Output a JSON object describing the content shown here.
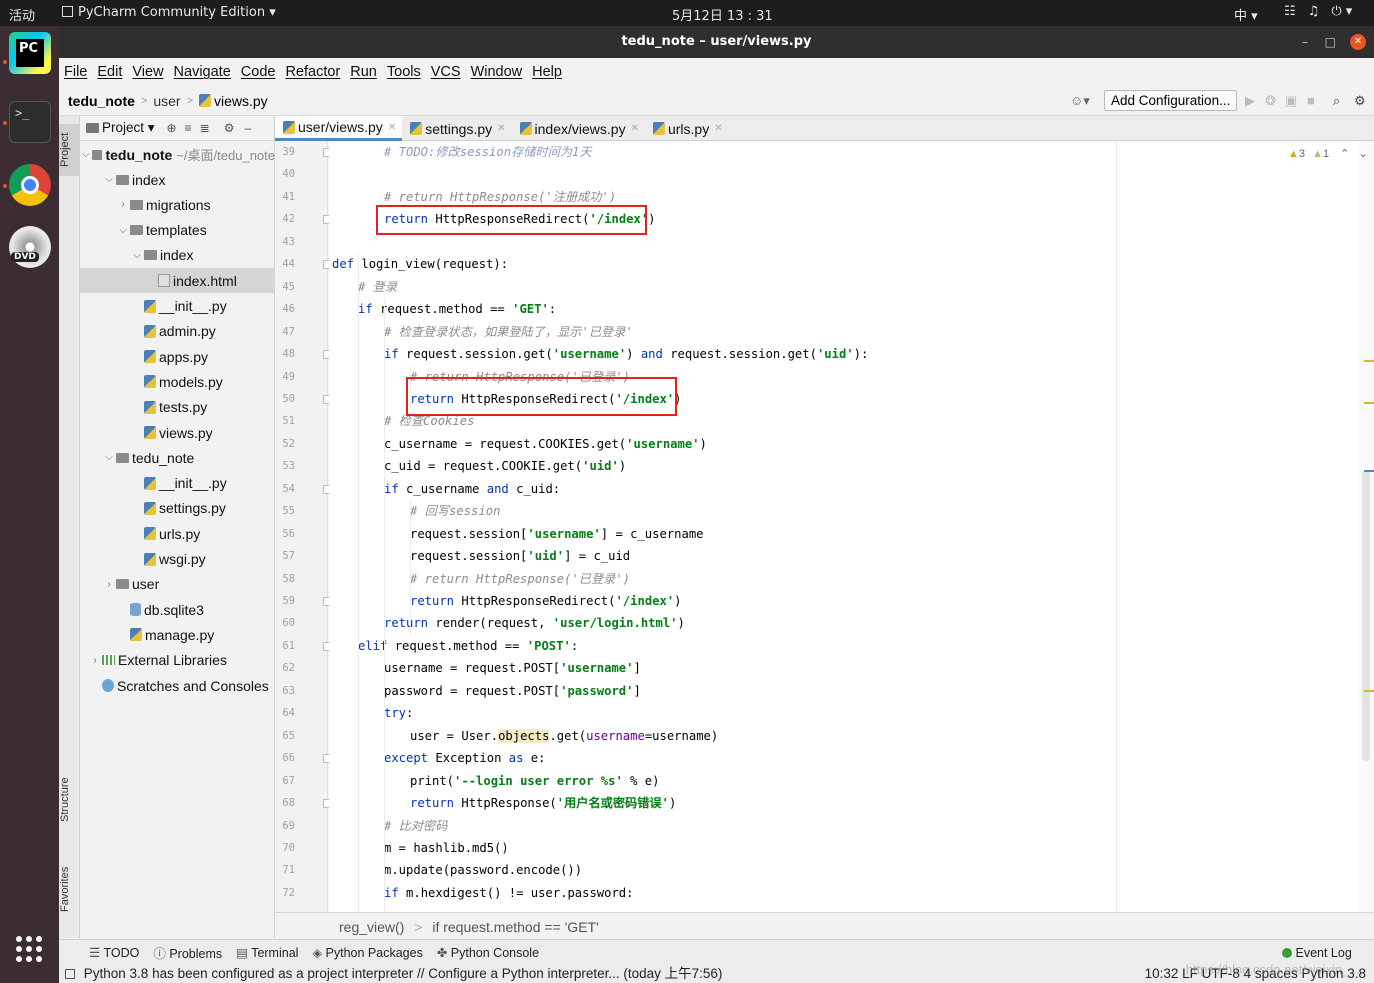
{
  "topbar": {
    "activities": "活动",
    "app_menu": "PyCharm Community Edition ▾",
    "clock": "5月12日 13 : 31",
    "ime": "中 ▾"
  },
  "window": {
    "title": "tedu_note – user/views.py"
  },
  "menu": [
    "File",
    "Edit",
    "View",
    "Navigate",
    "Code",
    "Refactor",
    "Run",
    "Tools",
    "VCS",
    "Window",
    "Help"
  ],
  "nav": {
    "project": "tedu_note",
    "folder": "user",
    "file": "views.py",
    "add_config": "Add Configuration..."
  },
  "sidestrip": {
    "project": "Project",
    "structure": "Structure",
    "favorites": "Favorites"
  },
  "project_panel": {
    "label": "Project ▾",
    "root_name": "tedu_note",
    "root_path": "~/桌面/tedu_note"
  },
  "tree": [
    {
      "label": "index",
      "type": "folder",
      "depth": 1,
      "arrow": "open"
    },
    {
      "label": "migrations",
      "type": "folder",
      "depth": 2,
      "arrow": "closed"
    },
    {
      "label": "templates",
      "type": "folder",
      "depth": 2,
      "arrow": "open"
    },
    {
      "label": "index",
      "type": "folder",
      "depth": 3,
      "arrow": "open"
    },
    {
      "label": "index.html",
      "type": "html",
      "depth": 4,
      "arrow": "none",
      "selected": true
    },
    {
      "label": "__init__.py",
      "type": "py",
      "depth": 3,
      "arrow": "none"
    },
    {
      "label": "admin.py",
      "type": "py",
      "depth": 3,
      "arrow": "none"
    },
    {
      "label": "apps.py",
      "type": "py",
      "depth": 3,
      "arrow": "none"
    },
    {
      "label": "models.py",
      "type": "py",
      "depth": 3,
      "arrow": "none"
    },
    {
      "label": "tests.py",
      "type": "py",
      "depth": 3,
      "arrow": "none"
    },
    {
      "label": "views.py",
      "type": "py",
      "depth": 3,
      "arrow": "none"
    },
    {
      "label": "tedu_note",
      "type": "folder",
      "depth": 1,
      "arrow": "open"
    },
    {
      "label": "__init__.py",
      "type": "py",
      "depth": 3,
      "arrow": "none"
    },
    {
      "label": "settings.py",
      "type": "py",
      "depth": 3,
      "arrow": "none"
    },
    {
      "label": "urls.py",
      "type": "py",
      "depth": 3,
      "arrow": "none"
    },
    {
      "label": "wsgi.py",
      "type": "py",
      "depth": 3,
      "arrow": "none"
    },
    {
      "label": "user",
      "type": "folder",
      "depth": 1,
      "arrow": "closed"
    },
    {
      "label": "db.sqlite3",
      "type": "db",
      "depth": 2,
      "arrow": "none"
    },
    {
      "label": "manage.py",
      "type": "py",
      "depth": 2,
      "arrow": "none"
    },
    {
      "label": "External Libraries",
      "type": "lib",
      "depth": 0,
      "arrow": "closed"
    },
    {
      "label": "Scratches and Consoles",
      "type": "scratch",
      "depth": 0,
      "arrow": "none"
    }
  ],
  "tabs": [
    {
      "label": "user/views.py",
      "active": true
    },
    {
      "label": "settings.py",
      "active": false
    },
    {
      "label": "index/views.py",
      "active": false
    },
    {
      "label": "urls.py",
      "active": false
    }
  ],
  "code_lines": [
    {
      "n": "39",
      "indent": 2,
      "html": "<span class='cmb'># TODO:修改session存储时间为1天</span>"
    },
    {
      "n": "40",
      "indent": 0,
      "html": ""
    },
    {
      "n": "41",
      "indent": 2,
      "html": "<span class='cm'># return HttpResponse('注册成功')</span>"
    },
    {
      "n": "42",
      "indent": 2,
      "html": "<span class='kw'>return</span> HttpResponseRedirect(<span class='str'>'/index'</span>)"
    },
    {
      "n": "43",
      "indent": 0,
      "html": ""
    },
    {
      "n": "44",
      "indent": 0,
      "html": "<span class='kw'>def</span> login_view(request):"
    },
    {
      "n": "45",
      "indent": 1,
      "html": "<span class='cm'># 登录</span>"
    },
    {
      "n": "46",
      "indent": 1,
      "html": "<span class='kw'>if</span> request.method == <span class='str'>'GET'</span>:"
    },
    {
      "n": "47",
      "indent": 2,
      "html": "<span class='cm'># 检查登录状态，如果登陆了，显示'已登录'</span>"
    },
    {
      "n": "48",
      "indent": 2,
      "html": "<span class='kw'>if</span> request.session.get(<span class='str'>'username'</span>) <span class='kw'>and</span> request.session.get(<span class='str'>'uid'</span>):"
    },
    {
      "n": "49",
      "indent": 3,
      "html": "<span class='cm'># return HttpResponse('已登录')</span>"
    },
    {
      "n": "50",
      "indent": 3,
      "html": "<span class='kw'>return</span> HttpResponseRedirect(<span class='str'>'/index'</span>)"
    },
    {
      "n": "51",
      "indent": 2,
      "html": "<span class='cm'># 检查Cookies</span>"
    },
    {
      "n": "52",
      "indent": 2,
      "html": "c_username = request.COOKIES.get(<span class='str'>'username'</span>)"
    },
    {
      "n": "53",
      "indent": 2,
      "html": "c_uid = request.COOKIE.get(<span class='str'>'uid'</span>)"
    },
    {
      "n": "54",
      "indent": 2,
      "html": "<span class='kw'>if</span> c_username <span class='kw'>and</span> c_uid:"
    },
    {
      "n": "55",
      "indent": 3,
      "html": "<span class='cm'># 回写session</span>"
    },
    {
      "n": "56",
      "indent": 3,
      "html": "request.session[<span class='str'>'username'</span>] = c_username"
    },
    {
      "n": "57",
      "indent": 3,
      "html": "request.session[<span class='str'>'uid'</span>] = c_uid"
    },
    {
      "n": "58",
      "indent": 3,
      "html": "<span class='cm'># return HttpResponse('已登录')</span>"
    },
    {
      "n": "59",
      "indent": 3,
      "html": "<span class='kw'>return</span> HttpResponseRedirect(<span class='str'>'/index'</span>)"
    },
    {
      "n": "60",
      "indent": 2,
      "html": "<span class='kw'>return</span> render(request, <span class='str'>'user/login.html'</span>)"
    },
    {
      "n": "61",
      "indent": 1,
      "html": "<span class='kw'>elif</span> request.method == <span class='str'>'POST'</span>:"
    },
    {
      "n": "62",
      "indent": 2,
      "html": "username = request.POST[<span class='str'>'username'</span>]"
    },
    {
      "n": "63",
      "indent": 2,
      "html": "password = request.POST[<span class='str'>'password'</span>]"
    },
    {
      "n": "64",
      "indent": 2,
      "html": "<span class='kw'>try</span>:"
    },
    {
      "n": "65",
      "indent": 3,
      "html": "user = User.<span class='hl'>objects</span>.get(<span class='prm'>username</span>=username)"
    },
    {
      "n": "66",
      "indent": 2,
      "html": "<span class='kw'>except</span> Exception <span class='kw'>as</span> e:"
    },
    {
      "n": "67",
      "indent": 3,
      "html": "print(<span class='str'>'--login user error %s'</span> % e)"
    },
    {
      "n": "68",
      "indent": 3,
      "html": "<span class='kw'>return</span> HttpResponse(<span class='str'>'用户名或密码错误'</span>)"
    },
    {
      "n": "69",
      "indent": 2,
      "html": "<span class='cm'># 比对密码</span>"
    },
    {
      "n": "70",
      "indent": 2,
      "html": "m = hashlib.md5()"
    },
    {
      "n": "71",
      "indent": 2,
      "html": "m.update(password.encode())"
    },
    {
      "n": "72",
      "indent": 2,
      "html": "<span class='kw'>if</span> m.hexdigest() != user.password:"
    }
  ],
  "warnings": {
    "warn": "3",
    "weak": "1"
  },
  "breadcrumb": {
    "fn": "reg_view()",
    "cond": "if request.method == 'GET'"
  },
  "bottom_tabs": [
    "TODO",
    "Problems",
    "Terminal",
    "Python Packages",
    "Python Console"
  ],
  "event_log": "Event Log",
  "status": {
    "message": "Python 3.8 has been configured as a project interpreter // Configure a Python interpreter... (today 上午7:56)",
    "right": "10:32   LF   UTF-8   4 spaces   Python 3.8"
  },
  "watermark": "https://blog.csdn.net/weixin_..."
}
